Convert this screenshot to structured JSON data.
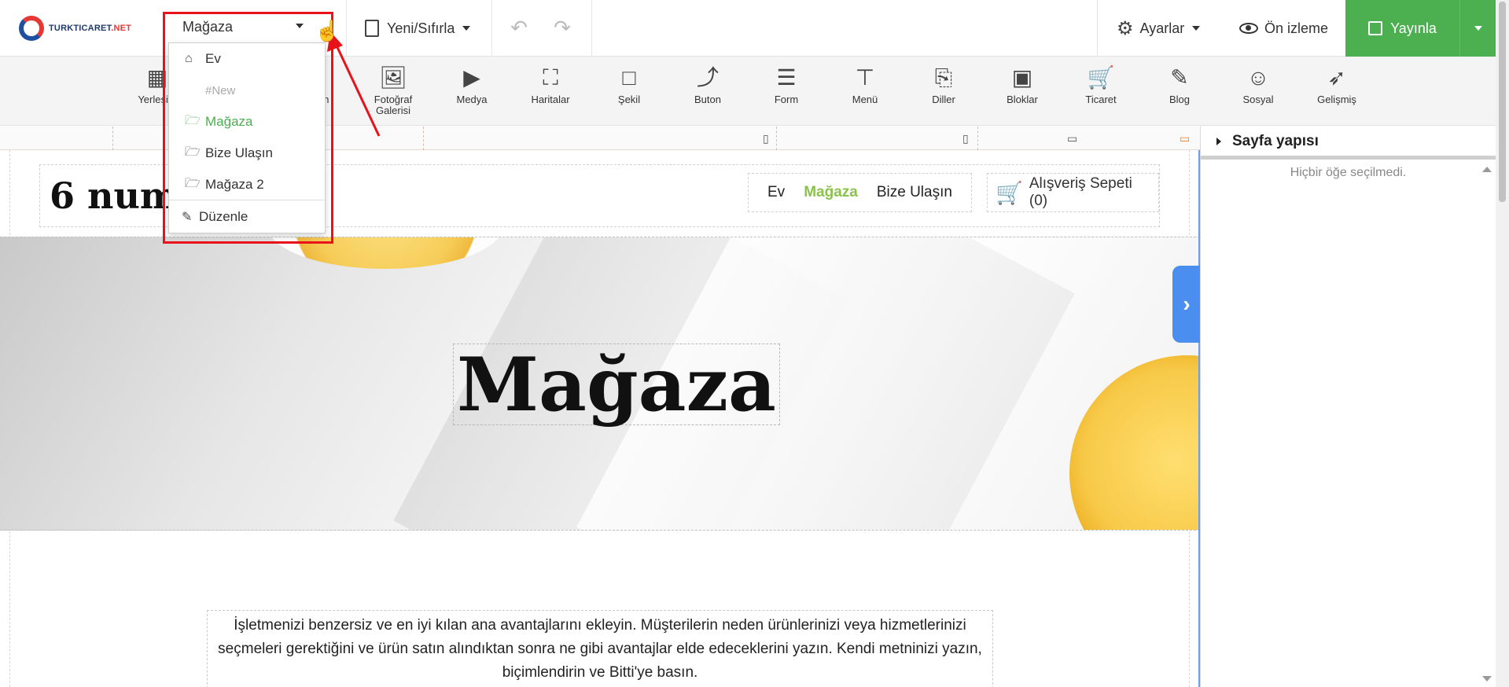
{
  "topbar": {
    "logo_text": "TURKTICARET",
    "logo_accent": ".NET",
    "page_select": "Mağaza",
    "new_reset": "Yeni/Sıfırla",
    "settings": "Ayarlar",
    "preview": "Ön izleme",
    "publish": "Yayınla"
  },
  "tools": [
    {
      "label": "Yerleşim",
      "icon": "layout-icon"
    },
    {
      "label": "Resim",
      "icon": "image-icon"
    },
    {
      "label": "Fotoğraf Galerisi",
      "icon": "gallery-icon"
    },
    {
      "label": "Medya",
      "icon": "play-icon"
    },
    {
      "label": "Haritalar",
      "icon": "map-icon"
    },
    {
      "label": "Şekil",
      "icon": "shape-icon"
    },
    {
      "label": "Buton",
      "icon": "share-icon"
    },
    {
      "label": "Form",
      "icon": "form-icon"
    },
    {
      "label": "Menü",
      "icon": "sitemap-icon"
    },
    {
      "label": "Diller",
      "icon": "language-icon"
    },
    {
      "label": "Bloklar",
      "icon": "blocks-icon"
    },
    {
      "label": "Ticaret",
      "icon": "cart-icon"
    },
    {
      "label": "Blog",
      "icon": "edit-icon"
    },
    {
      "label": "Sosyal",
      "icon": "users-icon"
    },
    {
      "label": "Gelişmiş",
      "icon": "rocket-icon"
    }
  ],
  "dropdown": {
    "items": [
      {
        "label": "Ev",
        "icon": "home-icon"
      },
      {
        "label": "#New",
        "icon": ""
      },
      {
        "label": "Mağaza",
        "icon": "folder-open-icon",
        "active": true
      },
      {
        "label": "Bize Ulaşın",
        "icon": "folder-open-icon"
      },
      {
        "label": "Mağaza 2",
        "icon": "folder-open-icon"
      }
    ],
    "edit": "Düzenle"
  },
  "site": {
    "title": "6 num",
    "nav": [
      "Ev",
      "Mağaza",
      "Bize Ulaşın"
    ],
    "cart": "Alışveriş Sepeti (0)",
    "hero_title": "Mağaza",
    "feature_text": "İşletmenizi benzersiz ve en iyi kılan ana avantajlarını ekleyin. Müşterilerin neden ürünlerinizi veya hizmetlerinizi seçmeleri gerektiğini ve ürün satın alındıktan sonra ne gibi avantajlar elde edeceklerini yazın. Kendi metninizi yazın, biçimlendirin ve Bitti'ye basın."
  },
  "panel": {
    "title": "Sayfa yapısı",
    "empty": "Hiçbir öğe seçilmedi."
  },
  "colors": {
    "publish": "#4caf50",
    "active_nav": "#8bc34a",
    "highlight": "#e8121a",
    "side_toggle": "#4a8ff0"
  }
}
